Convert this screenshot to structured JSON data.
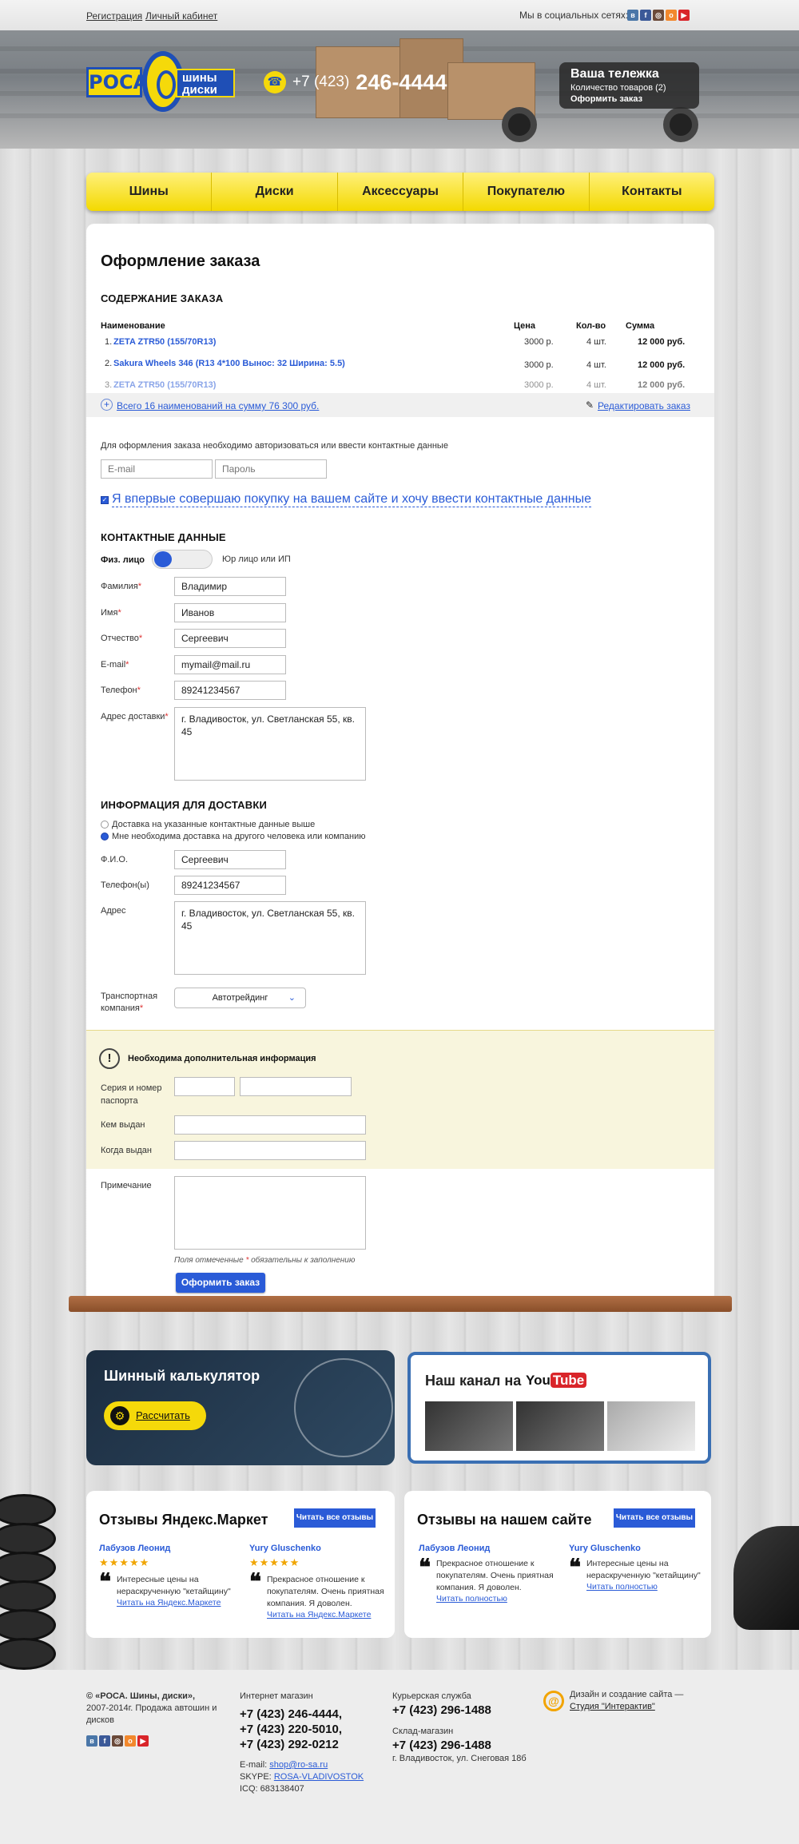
{
  "top": {
    "register": "Регистрация",
    "cabinet": "Личный кабинет",
    "social_label": "Мы в социальных сетях:",
    "social_icons": [
      "vk-icon",
      "facebook-icon",
      "instagram-icon",
      "odnoklassniki-icon",
      "youtube-icon"
    ]
  },
  "logo": {
    "roca": "РОСА",
    "line1": "шины",
    "line2": "диски"
  },
  "phone": {
    "code": "+7 (423)",
    "number": "246-4444"
  },
  "cart": {
    "title": "Ваша тележка",
    "count": "Количество товаров (2)",
    "checkout": "Оформить заказ"
  },
  "nav": [
    "Шины",
    "Диски",
    "Аксессуары",
    "Покупателю",
    "Контакты"
  ],
  "order": {
    "title": "Оформление заказа",
    "contents_heading": "СОДЕРЖАНИЕ ЗАКАЗА",
    "columns": {
      "name": "Наименование",
      "price": "Цена",
      "qty": "Кол-во",
      "sum": "Сумма"
    },
    "rows": [
      {
        "n": "1.",
        "name": "ZETA ZTR50 (155/70R13)",
        "price": "3000 р.",
        "qty": "4 шт.",
        "sum": "12 000 руб."
      },
      {
        "n": "2.",
        "name": "Sakura Wheels 346 (R13 4*100 Вынос: 32 Ширина: 5.5)",
        "price": "3000 р.",
        "qty": "4 шт.",
        "sum": "12 000 руб."
      },
      {
        "n": "3.",
        "name": "ZETA ZTR50 (155/70R13)",
        "price": "3000 р.",
        "qty": "4 шт.",
        "sum": "12 000 руб."
      }
    ],
    "total_link": "Всего 16 наименований на сумму 76 300 руб.",
    "edit_link": "Редактировать заказ"
  },
  "auth": {
    "note": "Для оформления заказа необходимо авторизоваться или ввести контактные данные",
    "email_placeholder": "E-mail",
    "password_placeholder": "Пароль",
    "first_time": "Я впервые совершаю покупку на вашем сайте и хочу ввести контактные данные"
  },
  "contacts": {
    "heading": "КОНТАКТНЫЕ ДАННЫЕ",
    "individual": "Физ. лицо",
    "legal": "Юр лицо или ИП",
    "fields": [
      {
        "label": "Фамилия",
        "value": "Владимир"
      },
      {
        "label": "Имя",
        "value": "Иванов"
      },
      {
        "label": "Отчество",
        "value": "Сергеевич"
      },
      {
        "label": "E-mail",
        "value": "mymail@mail.ru"
      },
      {
        "label": "Телефон",
        "value": "89241234567"
      }
    ],
    "address_label": "Адрес доставки",
    "address_value": "г. Владивосток, ул. Светланская 55, кв. 45"
  },
  "delivery": {
    "heading": "ИНФОРМАЦИЯ ДЛЯ ДОСТАВКИ",
    "option1": "Доставка на указанные контактные данные выше",
    "option2": "Мне необходима доставка на другого человека или компанию",
    "fio_label": "Ф.И.О.",
    "fio_value": "Сергеевич",
    "phone_label": "Телефон(ы)",
    "phone_value": "89241234567",
    "address_label": "Адрес",
    "address_value": "г. Владивосток, ул. Светланская 55, кв. 45",
    "company_label_1": "Транспортная",
    "company_label_2": "компания",
    "company_value": "Автотрейдинг"
  },
  "extra": {
    "title": "Необходима дополнительная информация",
    "passport_1": "Серия и номер",
    "passport_2": "паспорта",
    "issued_by": "Кем выдан",
    "issued_when": "Когда выдан"
  },
  "note_label": "Примечание",
  "required_note_a": "Поля отмеченные",
  "required_star": "*",
  "required_note_b": "обязательны к заполнению",
  "submit": "Оформить заказ",
  "calc": {
    "title": "Шинный калькулятор",
    "button": "Рассчитать"
  },
  "youtube": {
    "title": "Наш канал на",
    "you": "You",
    "tube": "Tube"
  },
  "reviews_market": {
    "title": "Отзывы Яндекс.Маркет",
    "button": "Читать все отзывы",
    "items": [
      {
        "author": "Лабузов Леонид",
        "stars": "★★★★★",
        "text": "Интересные цены на нераскрученную \"кетайщину\"",
        "link": "Читать на Яндекс.Маркете"
      },
      {
        "author": "Yury Gluschenko",
        "stars": "★★★★★",
        "text": "Прекрасное отношение к покупателям. Очень приятная компания. Я доволен.",
        "link": "Читать на Яндекс.Маркете"
      }
    ]
  },
  "reviews_site": {
    "title": "Отзывы на нашем сайте",
    "button": "Читать все отзывы",
    "items": [
      {
        "author": "Лабузов Леонид",
        "text": "Прекрасное отношение к покупателям. Очень приятная компания. Я доволен.",
        "link": "Читать полностью"
      },
      {
        "author": "Yury Gluschenko",
        "text": "Интересные цены на нераскрученную \"кетайщину\"",
        "link": "Читать полностью"
      }
    ]
  },
  "footer": {
    "copyright_bold": "© «РОСА. Шины, диски»,",
    "copyright": "2007-2014г. Продажа автошин и дисков",
    "shop_label": "Интернет магазин",
    "shop_phones": [
      "+7 (423) 246-4444,",
      "+7 (423) 220-5010,",
      "+7 (423) 292-0212"
    ],
    "email_label": "E-mail:",
    "email": "shop@ro-sa.ru",
    "skype_label": "SKYPE:",
    "skype": "ROSA-VLADIVOSTOK",
    "icq": "ICQ: 683138407",
    "courier_label": "Курьерская служба",
    "courier_phone": "+7 (423) 296-1488",
    "warehouse_label": "Склад-магазин",
    "warehouse_phone": "+7 (423) 296-1488",
    "warehouse_address": "г. Владивосток, ул. Снеговая 18б",
    "design_label": "Дизайн и создание сайта —",
    "design_link": "Студия \"Интерактив\""
  },
  "colors": {
    "accent": "#2a5bd7",
    "yellow": "#f3d900",
    "brand_blue": "#1f4fb6",
    "warn_bg": "#f8f5dd"
  }
}
